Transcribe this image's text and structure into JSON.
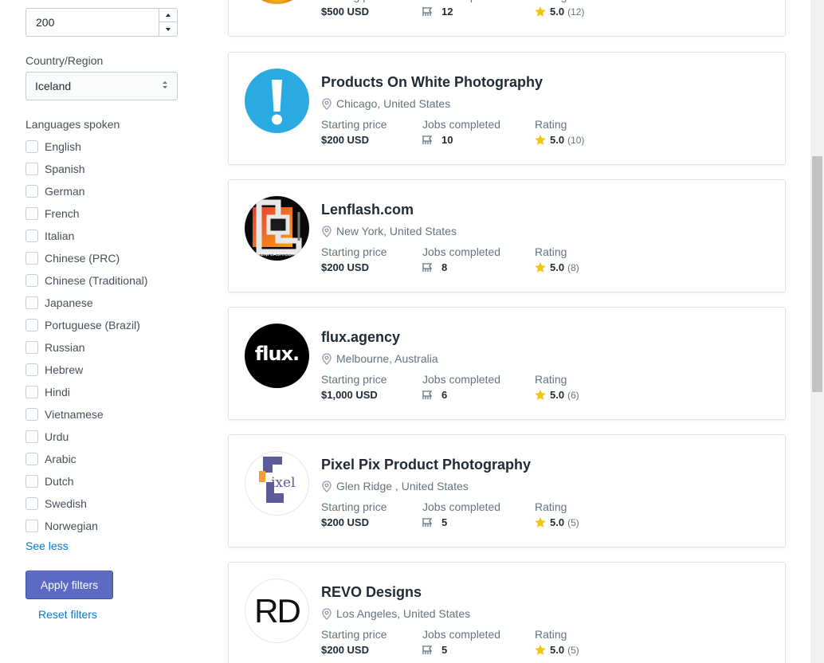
{
  "filters": {
    "rate_input_value": "200",
    "country_label": "Country/Region",
    "country_value": "Iceland",
    "languages_label": "Languages spoken",
    "languages": [
      "English",
      "Spanish",
      "German",
      "French",
      "Italian",
      "Chinese (PRC)",
      "Chinese (Traditional)",
      "Japanese",
      "Portuguese (Brazil)",
      "Russian",
      "Hebrew",
      "Hindi",
      "Vietnamese",
      "Urdu",
      "Arabic",
      "Dutch",
      "Swedish",
      "Norwegian"
    ],
    "see_less": "See less",
    "apply_label": "Apply filters",
    "reset_label": "Reset filters"
  },
  "stat_labels": {
    "starting_price": "Starting price",
    "jobs_completed": "Jobs completed",
    "rating": "Rating"
  },
  "colors": {
    "accent": "#5c6ac4",
    "link": "#007ace",
    "star": "#f1c40f"
  },
  "listings": [
    {
      "name": "",
      "location": "",
      "starting_price": "$500 USD",
      "jobs_completed": "12",
      "rating": "5.0",
      "rating_count": "(12)"
    },
    {
      "name": "Products On White Photography",
      "location": "Chicago, United States",
      "starting_price": "$200 USD",
      "jobs_completed": "10",
      "rating": "5.0",
      "rating_count": "(10)",
      "logo_icon": "exclamation-icon"
    },
    {
      "name": "Lenflash.com",
      "location": "New York, United States",
      "starting_price": "$200 USD",
      "jobs_completed": "8",
      "rating": "5.0",
      "rating_count": "(8)",
      "logo_text": "LENFLASH.COM"
    },
    {
      "name": "flux.agency",
      "location": "Melbourne, Australia",
      "starting_price": "$1,000 USD",
      "jobs_completed": "6",
      "rating": "5.0",
      "rating_count": "(6)",
      "logo_text": "flux."
    },
    {
      "name": "Pixel Pix Product Photography",
      "location": "Glen Ridge , United States",
      "starting_price": "$200 USD",
      "jobs_completed": "5",
      "rating": "5.0",
      "rating_count": "(5)",
      "logo_text": "ixel"
    },
    {
      "name": "REVO Designs",
      "location": "Los Angeles, United States",
      "starting_price": "$200 USD",
      "jobs_completed": "5",
      "rating": "5.0",
      "rating_count": "(5)",
      "logo_text": "RD"
    }
  ]
}
